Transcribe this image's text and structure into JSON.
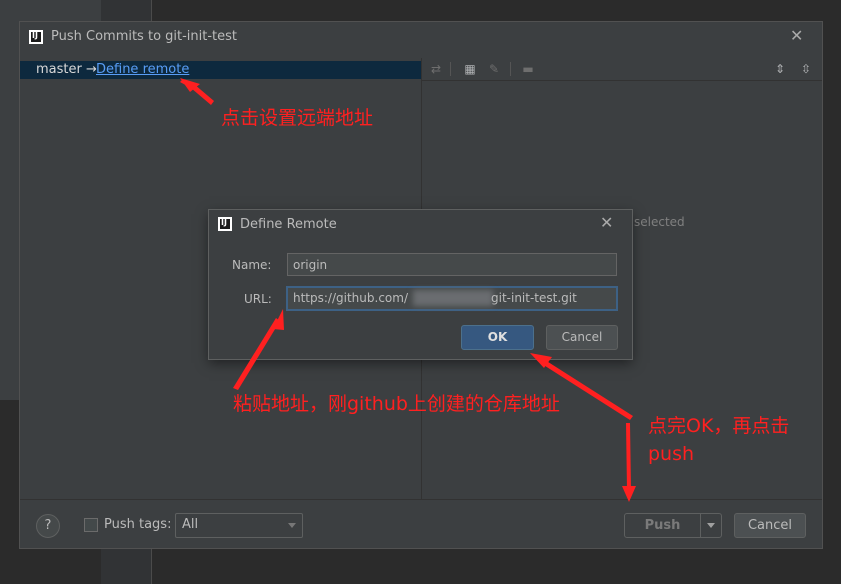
{
  "push_dialog": {
    "title": "Push Commits to git-init-test",
    "close_glyph": "✕",
    "branch": {
      "local": "master →",
      "define_remote_link": "Define remote"
    },
    "empty_text": "selected",
    "footer": {
      "help_glyph": "?",
      "push_tags_label": "Push tags:",
      "push_tags_value": "All",
      "push_button": "Push",
      "cancel_button": "Cancel"
    }
  },
  "define_remote_dialog": {
    "title": "Define Remote",
    "close_glyph": "✕",
    "name_label": "Name:",
    "name_value": "origin",
    "url_label": "URL:",
    "url_prefix": "https://github.com/",
    "url_suffix": "git-init-test.git",
    "ok_button": "OK",
    "cancel_button": "Cancel"
  },
  "annotations": {
    "define_remote_hint": "点击设置远端地址",
    "paste_hint": "粘贴地址，刚github上创建的仓库地址",
    "ok_push_hint_line1": "点完OK，再点击",
    "ok_push_hint_line2": "push",
    "color": "#ff2020"
  }
}
